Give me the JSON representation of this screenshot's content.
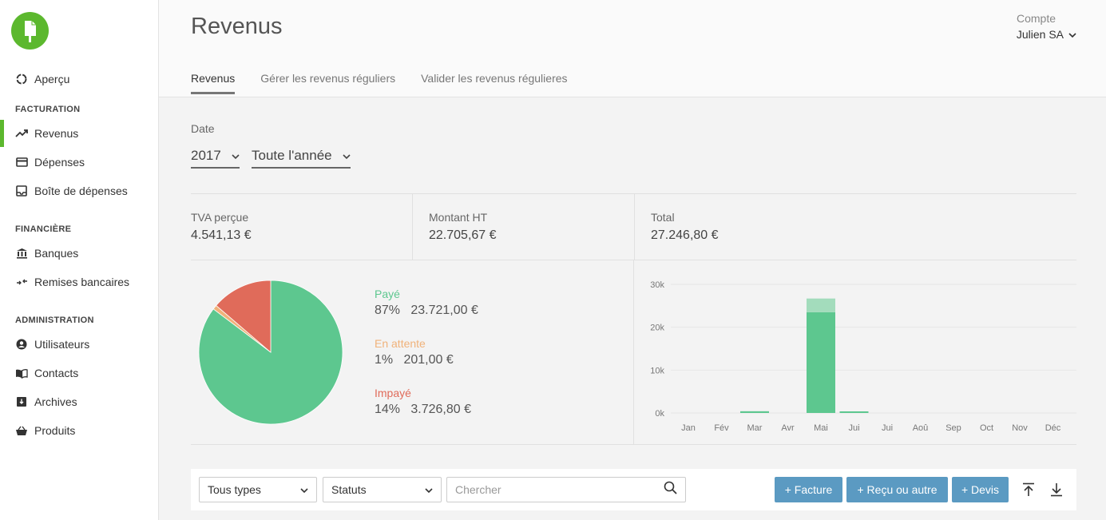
{
  "sidebar": {
    "items": [
      {
        "label": "Aperçu",
        "icon": "circle-notch-icon"
      },
      {
        "label": "Revenus",
        "icon": "trend-up-icon"
      },
      {
        "label": "Dépenses",
        "icon": "credit-card-icon"
      },
      {
        "label": "Boîte de dépenses",
        "icon": "inbox-icon"
      },
      {
        "label": "Banques",
        "icon": "bank-icon"
      },
      {
        "label": "Remises bancaires",
        "icon": "transfer-icon"
      },
      {
        "label": "Utilisateurs",
        "icon": "user-circle-icon"
      },
      {
        "label": "Contacts",
        "icon": "book-icon"
      },
      {
        "label": "Archives",
        "icon": "archive-icon"
      },
      {
        "label": "Produits",
        "icon": "basket-icon"
      }
    ],
    "sections": [
      "FACTURATION",
      "FINANCIÈRE",
      "ADMINISTRATION"
    ],
    "active": "Revenus"
  },
  "header": {
    "title": "Revenus",
    "account_label": "Compte",
    "account_name": "Julien SA",
    "tabs": [
      "Revenus",
      "Gérer les revenus réguliers",
      "Valider les revenus régulieres"
    ]
  },
  "filters": {
    "date_label": "Date",
    "year": "2017",
    "period": "Toute l'année"
  },
  "stats": [
    {
      "label": "TVA perçue",
      "value": "4.541,13 €"
    },
    {
      "label": "Montant HT",
      "value": "22.705,67 €"
    },
    {
      "label": "Total",
      "value": "27.246,80 €"
    }
  ],
  "legend": [
    {
      "label": "Payé",
      "value": "87%   23.721,00 €",
      "color": "#5dc78f"
    },
    {
      "label": "En attente",
      "value": "1%   201,00 €",
      "color": "#f0b27a"
    },
    {
      "label": "Impayé",
      "value": "14%   3.726,80 €",
      "color": "#e06b5a"
    }
  ],
  "chart_data": [
    {
      "type": "pie",
      "categories": [
        "Payé",
        "En attente",
        "Impayé"
      ],
      "values": [
        87,
        1,
        14
      ],
      "colors": [
        "#5dc78f",
        "#f0b27a",
        "#e06b5a"
      ]
    },
    {
      "type": "bar",
      "categories": [
        "Jan",
        "Fév",
        "Mar",
        "Avr",
        "Mai",
        "Jui",
        "Jui",
        "Aoû",
        "Sep",
        "Oct",
        "Nov",
        "Déc"
      ],
      "series": [
        {
          "values": [
            0,
            0,
            400,
            0,
            23500,
            300,
            0,
            0,
            0,
            0,
            0,
            0
          ],
          "color": "#5dc78f"
        },
        {
          "values": [
            0,
            0,
            0,
            0,
            3200,
            0,
            0,
            0,
            0,
            0,
            0,
            0
          ],
          "color": "#a3dcbc"
        }
      ],
      "yticks": [
        "0k",
        "10k",
        "20k",
        "30k"
      ],
      "ylim": [
        0,
        30000
      ],
      "grid": true
    }
  ],
  "toolbar": {
    "type_select": "Tous types",
    "status_select": "Statuts",
    "search_placeholder": "Chercher",
    "buttons": [
      "+ Facture",
      "+ Reçu ou autre",
      "+ Devis"
    ],
    "accent": "#5b9ac2"
  }
}
